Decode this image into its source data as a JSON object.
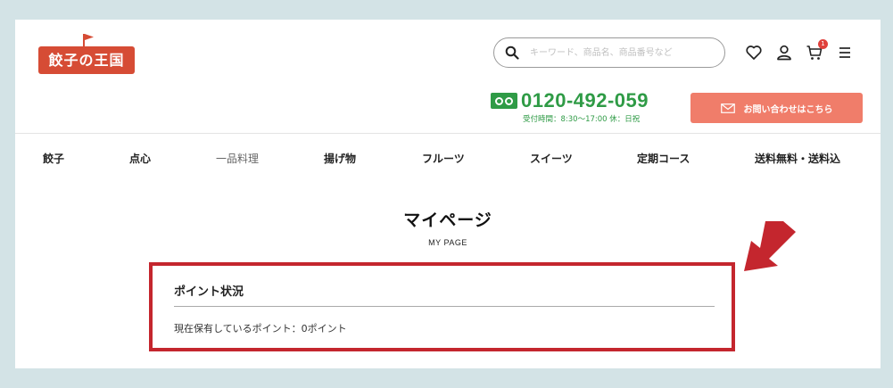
{
  "logo": {
    "text": "餃子の王国"
  },
  "search": {
    "placeholder": "キーワード、商品名、商品番号など"
  },
  "header_icons": {
    "cart_count": "1"
  },
  "phone": {
    "number": "0120-492-059",
    "hours": "受付時間：8:30〜17:00 休：日祝"
  },
  "contact": {
    "label": "お問い合わせはこちら"
  },
  "nav": {
    "items": [
      {
        "label": "餃子"
      },
      {
        "label": "点心"
      },
      {
        "label": "一品料理"
      },
      {
        "label": "揚げ物"
      },
      {
        "label": "フルーツ"
      },
      {
        "label": "スイーツ"
      },
      {
        "label": "定期コース"
      },
      {
        "label": "送料無料・送料込"
      }
    ]
  },
  "main": {
    "title": "マイページ",
    "subtitle": "MY PAGE",
    "points": {
      "heading": "ポイント状況",
      "value_text": "現在保有しているポイント：0ポイント"
    }
  },
  "colors": {
    "logo": "#d64c35",
    "phone_green": "#2f9b46",
    "contact_button": "#f07d6a",
    "highlight_border": "#c4262e",
    "background": "#d3e3e6"
  }
}
